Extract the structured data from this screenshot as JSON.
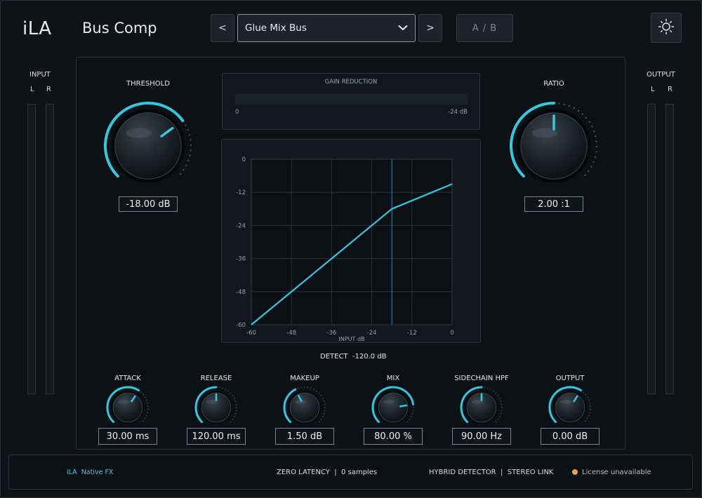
{
  "header": {
    "logo": "iLA",
    "plugin_name": "Bus Comp",
    "prev_label": "<",
    "next_label": ">",
    "preset_name": "Glue Mix Bus",
    "ab_label": "A / B",
    "settings_icon": "sun-icon"
  },
  "input_meter": {
    "label": "INPUT",
    "left": "L",
    "right": "R"
  },
  "output_meter": {
    "label": "OUTPUT",
    "left": "L",
    "right": "R"
  },
  "threshold": {
    "label": "THRESHOLD",
    "value": "-18.00 dB",
    "level": 0.7
  },
  "ratio": {
    "label": "RATIO",
    "value": "2.00 :1",
    "level": 0.5
  },
  "gain_reduction": {
    "title": "GAIN REDUCTION",
    "min_label": "0",
    "max_label": "-24 dB",
    "level": 0
  },
  "chart_data": {
    "type": "line",
    "xlabel": "INPUT dB",
    "ylabel": "",
    "xlim": [
      -60,
      0
    ],
    "ylim": [
      -60,
      0
    ],
    "x_ticks": [
      "-60",
      "-48",
      "-36",
      "-24",
      "-12",
      "0"
    ],
    "y_ticks": [
      "0",
      "-12",
      "-24",
      "-36",
      "-48",
      "-60"
    ],
    "grid": true,
    "threshold_marker": -18,
    "series": [
      {
        "x": [
          -60,
          -18,
          0
        ],
        "y": [
          -60,
          -18,
          -9
        ]
      }
    ]
  },
  "detect": {
    "label": "DETECT",
    "value": "-120.0 dB"
  },
  "small_knobs": [
    {
      "label": "ATTACK",
      "value": "30.00 ms",
      "level": 0.62
    },
    {
      "label": "RELEASE",
      "value": "120.00 ms",
      "level": 0.5
    },
    {
      "label": "MAKEUP",
      "value": "1.50 dB",
      "level": 0.4
    },
    {
      "label": "MIX",
      "value": "80.00 %",
      "level": 0.8
    },
    {
      "label": "SIDECHAIN HPF",
      "value": "90.00 Hz",
      "level": 0.5
    },
    {
      "label": "OUTPUT",
      "value": "0.00 dB",
      "level": 0.62
    }
  ],
  "footer": {
    "brand": "iLA  Native FX",
    "latency_label": "ZERO LATENCY",
    "latency_value": "0 samples",
    "detector": "HYBRID DETECTOR",
    "link": "STEREO LINK",
    "license": "License unavailable",
    "license_dot_color": "#e8a150"
  },
  "colors": {
    "accent": "#35c8dc",
    "background": "#0e1318"
  }
}
